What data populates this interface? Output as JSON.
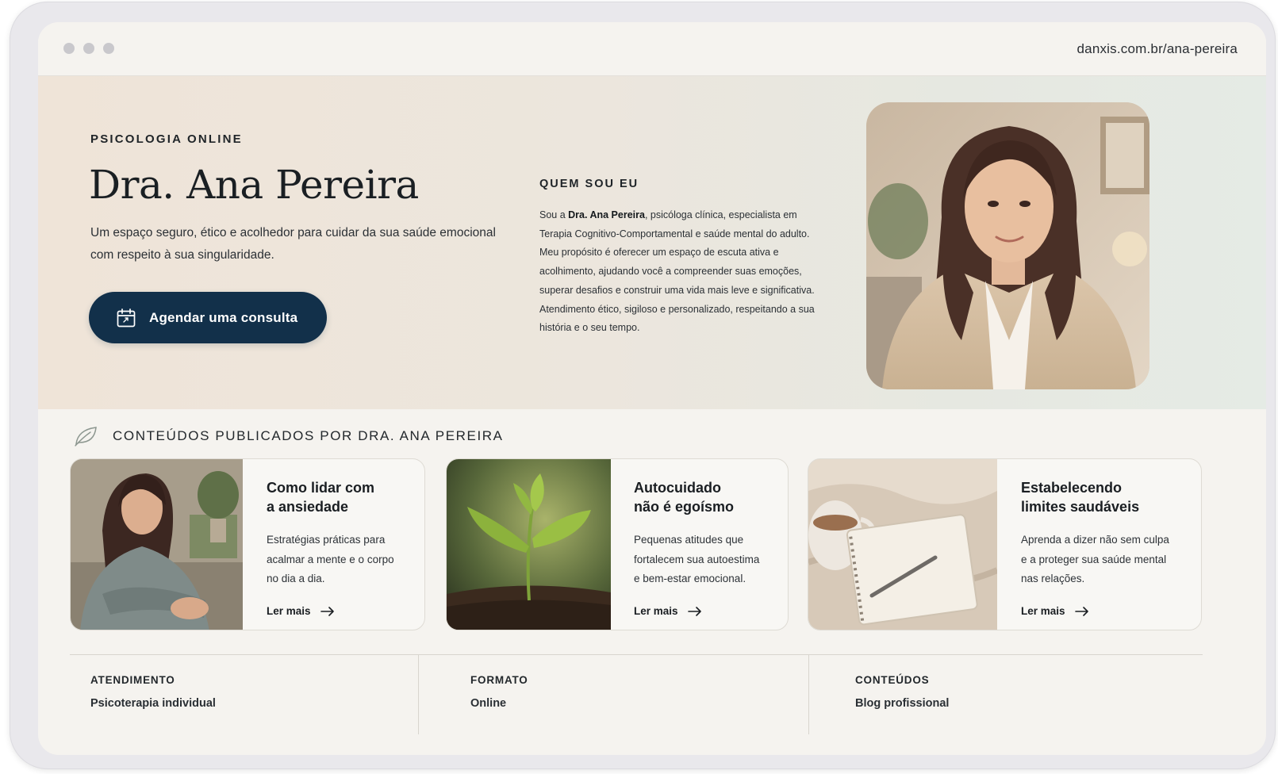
{
  "browser": {
    "url": "danxis.com.br/ana-pereira",
    "window_controls": [
      "close-dot",
      "minimize-dot",
      "zoom-dot"
    ]
  },
  "hero": {
    "eyebrow": "PSICOLOGIA ONLINE",
    "name": "Dra. Ana Pereira",
    "tagline": "Um espaço seguro, ético e acolhedor para cuidar da sua saúde emocional com respeito à sua singularidade.",
    "cta_label": "Agendar uma consulta",
    "cta_icon": "calendar-icon"
  },
  "about": {
    "title": "QUEM SOU EU",
    "intro_before": "Sou a ",
    "intro_name": "Dra. Ana Pereira",
    "intro_after": ", psicóloga clínica, especialista em Terapia Cognitivo-Comportamental e saúde mental do adulto. Meu propósito é oferecer um espaço de escuta ativa e acolhimento, ajudando você a compreender suas emoções, superar desafios e construir uma vida mais leve e significativa.",
    "closing": "Atendimento ético, sigiloso e personalizado, respeitando a sua história e o seu tempo."
  },
  "contents": {
    "section_icon": "leaf-icon",
    "section_title": "CONTEÚDOS PUBLICADOS POR DRA. ANA PEREIRA",
    "cards": [
      {
        "title": "Como lidar com\na ansiedade",
        "text": "Estratégias práticas para\nacalmar a mente e o corpo\nno dia a dia.",
        "link": "Ler mais"
      },
      {
        "title": "Autocuidado\nnão é egoísmo",
        "text": "Pequenas atitudes que\nfortalecem sua autoestima\ne bem-estar emocional.",
        "link": "Ler mais"
      },
      {
        "title": "Estabelecendo\nlimites saudáveis",
        "text": "Aprenda a dizer não sem culpa\ne a proteger sua saúde mental\nnas relações.",
        "link": "Ler mais"
      }
    ]
  },
  "info": [
    {
      "label": "ATENDIMENTO",
      "value": "Psicoterapia individual"
    },
    {
      "label": "FORMATO",
      "value": "Online"
    },
    {
      "label": "CONTEÚDOS",
      "value": "Blog profissional"
    }
  ],
  "colors": {
    "cta_background": "#12304a",
    "page_background": "#f5f3ef",
    "hero_gradient_start": "#efe4d8",
    "hero_gradient_end": "#e5ebe5"
  }
}
